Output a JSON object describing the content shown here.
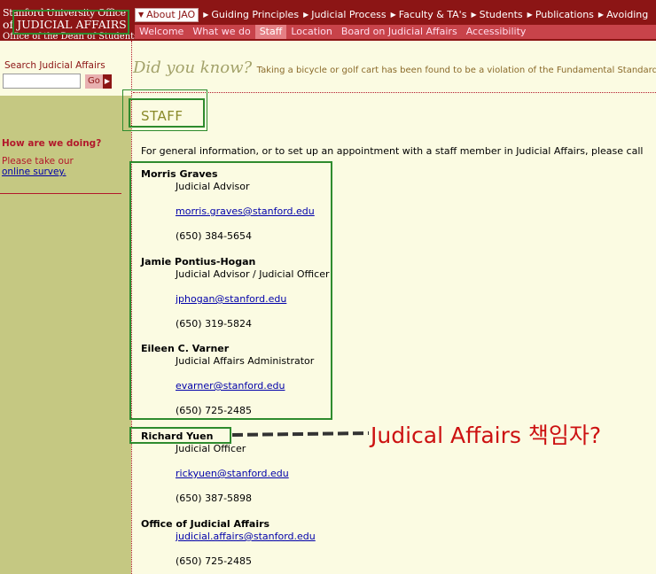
{
  "header": {
    "logo": {
      "line1": "Stanford University Office",
      "line2_prefix": "of",
      "line2_main": "JUDICIAL AFFAIRS",
      "line3": "Office of the Dean of Students"
    },
    "primary_nav": [
      {
        "label": "About JAO",
        "active": true
      },
      {
        "label": "Guiding Principles"
      },
      {
        "label": "Judicial Process"
      },
      {
        "label": "Faculty & TA's"
      },
      {
        "label": "Students"
      },
      {
        "label": "Publications"
      },
      {
        "label": "Avoiding"
      }
    ],
    "secondary_nav": [
      {
        "label": "Welcome"
      },
      {
        "label": "What we do"
      },
      {
        "label": "Staff",
        "active": true
      },
      {
        "label": "Location"
      },
      {
        "label": "Board on Judicial Affairs"
      },
      {
        "label": "Accessibility"
      }
    ]
  },
  "sidebar": {
    "search_label": "Search Judicial Affairs",
    "search_value": "",
    "go_label": "Go",
    "survey_title": "How are we doing?",
    "survey_text": "Please take our",
    "survey_link": "online survey."
  },
  "did_you_know": {
    "title": "Did you know?",
    "text": "Taking a bicycle or golf cart has been found to be a violation of the Fundamental Standard."
  },
  "main": {
    "title": "STAFF",
    "intro": "For general information, or to set up an appointment with a staff member in Judicial Affairs, please call",
    "people": [
      {
        "name": "Morris Graves",
        "role": "Judicial Advisor",
        "email": "morris.graves@stanford.edu",
        "phone": "(650) 384-5654"
      },
      {
        "name": "Jamie Pontius-Hogan",
        "role": "Judicial Advisor / Judicial Officer",
        "email": "jphogan@stanford.edu",
        "phone": "(650) 319-5824"
      },
      {
        "name": "Eileen C. Varner",
        "role": "Judicial Affairs Administrator",
        "email": "evarner@stanford.edu",
        "phone": "(650) 725-2485"
      },
      {
        "name": "Richard Yuen",
        "role": "Judicial Officer",
        "email": "rickyuen@stanford.edu",
        "phone": "(650) 387-5898"
      },
      {
        "name": "Office of Judicial Affairs",
        "role": "",
        "email": "judicial.affairs@stanford.edu",
        "phone": "(650) 725-2485"
      }
    ]
  },
  "annotation": {
    "text": "Judical Affairs 책임자?",
    "color": "#cc1111",
    "box_color": "#2e8b2e"
  }
}
